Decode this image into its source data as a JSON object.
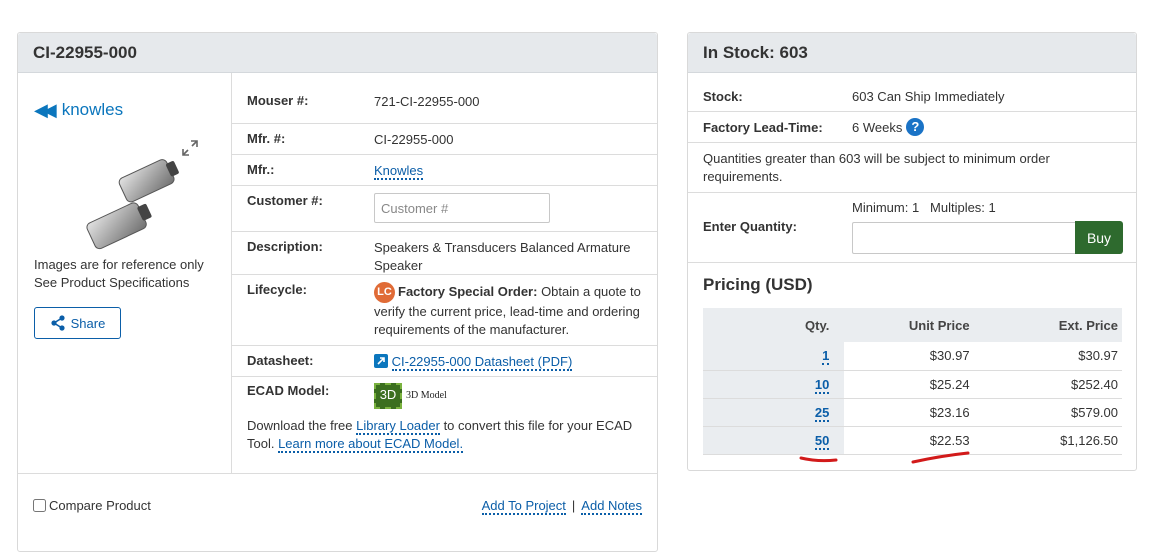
{
  "product": {
    "title": "CI-22955-000",
    "brand": "knowles",
    "ref_note_1": "Images are for reference only",
    "ref_note_2": "See Product Specifications",
    "share_label": "Share",
    "specs": {
      "mouser_label": "Mouser #:",
      "mouser_value": "721-CI-22955-000",
      "mfr_no_label": "Mfr. #:",
      "mfr_no_value": "CI-22955-000",
      "mfr_label": "Mfr.:",
      "mfr_value": "Knowles",
      "customer_label": "Customer #:",
      "customer_placeholder": "Customer #",
      "description_label": "Description:",
      "description_value": "Speakers & Transducers Balanced Armature Speaker",
      "lifecycle_label": "Lifecycle:",
      "lifecycle_badge": "LC",
      "lifecycle_bold": "Factory Special Order:",
      "lifecycle_text": " Obtain a quote to verify the current price, lead-time and ordering requirements of the manufacturer.",
      "datasheet_label": "Datasheet:",
      "datasheet_link": "CI-22955-000 Datasheet (PDF)",
      "ecad_label": "ECAD Model:",
      "ecad_chip": "3D",
      "ecad_3d_text": "3D Model",
      "ecad_text_1": "Download the free ",
      "ecad_link_1": "Library Loader",
      "ecad_text_2": " to convert this file for your ECAD Tool. ",
      "ecad_link_2": "Learn more about ECAD Model."
    },
    "compare_label": "Compare Product",
    "add_to_project": "Add To Project",
    "separator": "|",
    "add_notes": "Add Notes"
  },
  "stock": {
    "title": "In Stock: 603",
    "stock_label": "Stock:",
    "stock_value": "603 Can Ship Immediately",
    "lead_label": "Factory Lead-Time:",
    "lead_value": "6 Weeks",
    "help_glyph": "?",
    "qty_note": "Quantities greater than 603 will be subject to minimum order requirements.",
    "enter_qty_label": "Enter Quantity:",
    "min_mult": "Minimum: 1   Multiples: 1",
    "buy_label": "Buy",
    "pricing_title": "Pricing (USD)",
    "headers": {
      "qty": "Qty.",
      "unit": "Unit Price",
      "ext": "Ext. Price"
    },
    "rows": [
      {
        "qty": "1",
        "unit": "$30.97",
        "ext": "$30.97"
      },
      {
        "qty": "10",
        "unit": "$25.24",
        "ext": "$252.40"
      },
      {
        "qty": "25",
        "unit": "$23.16",
        "ext": "$579.00"
      },
      {
        "qty": "50",
        "unit": "$22.53",
        "ext": "$1,126.50"
      }
    ]
  },
  "colors": {
    "link": "#0b5ea8",
    "buy": "#2e6a2e",
    "lc_badge": "#e06b36",
    "annotation": "#d21a1a"
  }
}
